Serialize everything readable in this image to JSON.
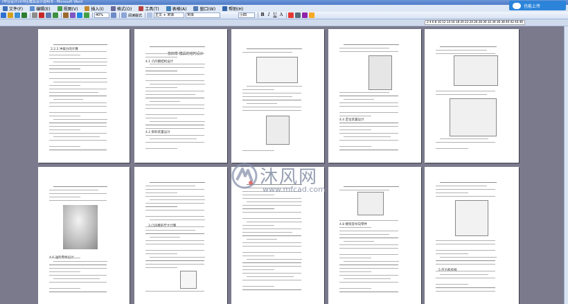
{
  "window": {
    "title": "(毕业设计)冷冲压模具设计说明书 - Microsoft Word"
  },
  "menu": [
    {
      "label": "文件(F)",
      "color": "#3b6db8"
    },
    {
      "label": "编辑(E)",
      "color": "#5c8fd0"
    },
    {
      "label": "视图(V)",
      "color": "#4a9a4a"
    },
    {
      "label": "插入(I)",
      "color": "#c48a2a"
    },
    {
      "label": "格式(O)",
      "color": "#6a6a9c"
    },
    {
      "label": "工具(T)",
      "color": "#b54040"
    },
    {
      "label": "表格(A)",
      "color": "#3e7fb8"
    },
    {
      "label": "窗口(W)",
      "color": "#5479b0"
    },
    {
      "label": "帮助(H)",
      "color": "#3366aa"
    }
  ],
  "cloud_button": {
    "label": "也能上传"
  },
  "toolbar": {
    "zoom_value": "40%",
    "read_mode_label": "阅读版式",
    "style_value": "正文 + 宋体",
    "font_value": "宋体",
    "size_value": "小四",
    "format_buttons": [
      "B",
      "I",
      "U",
      "A"
    ],
    "icon_colors": [
      "#2f6fcf",
      "#d4a020",
      "#3c8fd6",
      "#2e7d32",
      "#8c8c8c",
      "#c62828",
      "#5d7bb0",
      "#3d9140",
      "#9c6b30",
      "#7e57c2",
      "#1e88e5",
      "#43a047",
      "#e53935",
      "#546e7a",
      "#8e24aa",
      "#f9a825"
    ]
  },
  "ruler": {
    "scale": "2 4 6 8 10 12 14 16 18 20 22 24 26 28 30 32 34 36 38 40 42 44 46"
  },
  "pages": {
    "p1_heading": "2.2.2 冲裁力的计算",
    "p2_chapter": "第四章 模具的结构设计",
    "p2_section": "4.1 凸凹模结构设计",
    "p2_section2": "4.2 卸料装置设计",
    "p4_section": "4.4 定位装置设计",
    "p6_section": "4.6 送料零件设计",
    "p7_heading": "3 凸凹模的尺寸计算",
    "p9_section": "4.8 模架及导向零件",
    "p10_section": "5 压力机校核"
  },
  "watermark": {
    "title": "沐风网",
    "url": "www.mfcad.com"
  }
}
